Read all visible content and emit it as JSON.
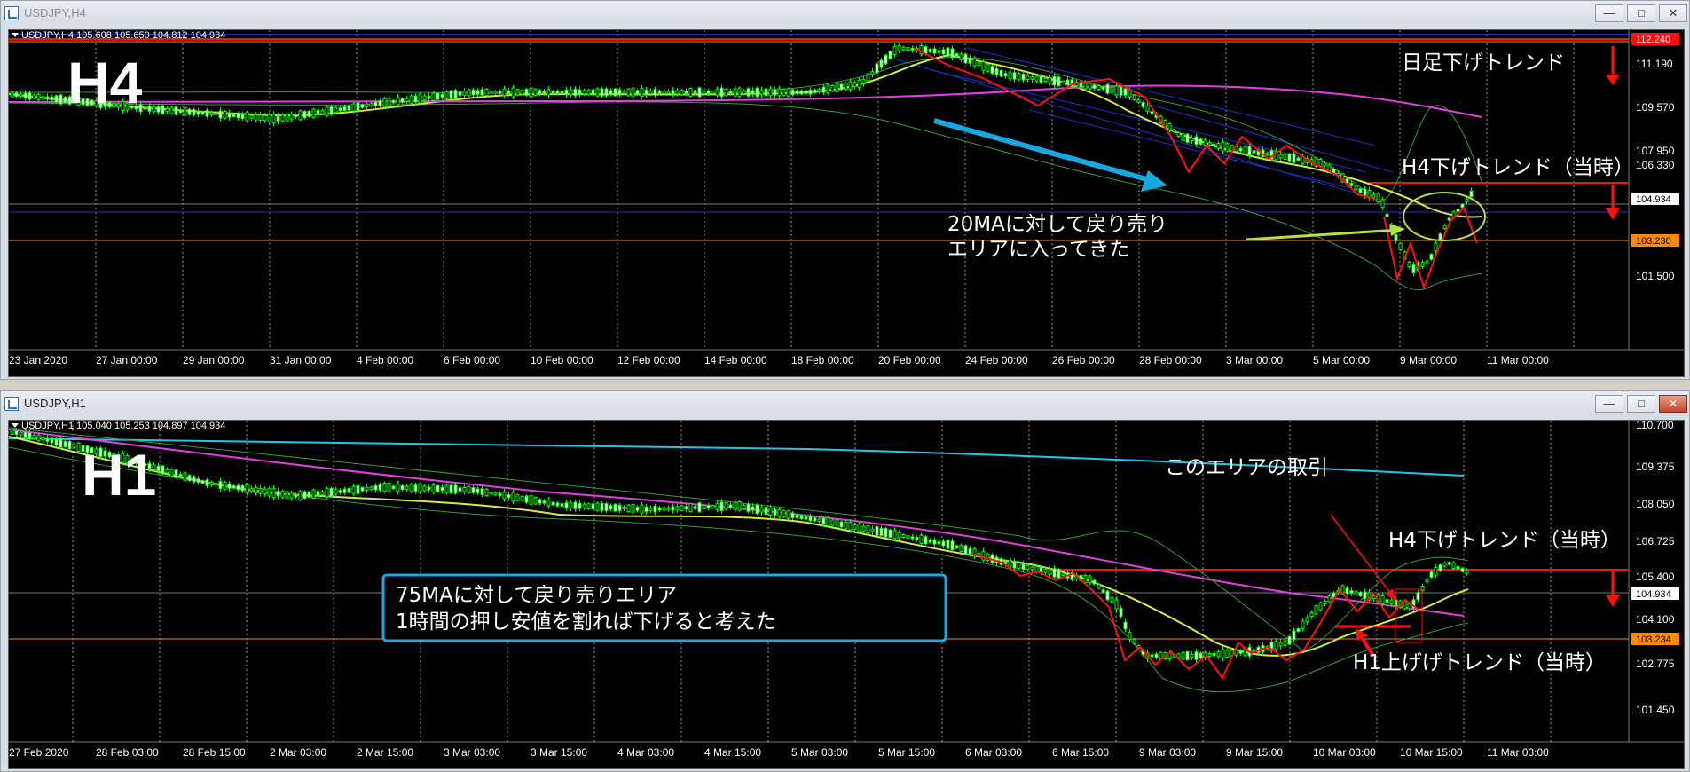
{
  "window_top": {
    "title": "USDJPY,H4",
    "info_line": "USDJPY,H4  105.608 105.650 104.812 104.934",
    "timeframe_label": "H4",
    "price_ticks": [
      "111.190",
      "109.570",
      "107.950",
      "106.330",
      "101.500"
    ],
    "price_tags": {
      "red": "112.240",
      "current": "104.934",
      "orange": "103.230"
    },
    "time_ticks": [
      "23 Jan 2020",
      "27 Jan 00:00",
      "29 Jan 00:00",
      "31 Jan 00:00",
      "4 Feb 00:00",
      "6 Feb 00:00",
      "10 Feb 00:00",
      "12 Feb 00:00",
      "14 Feb 00:00",
      "18 Feb 00:00",
      "20 Feb 00:00",
      "24 Feb 00:00",
      "26 Feb 00:00",
      "28 Feb 00:00",
      "3 Mar 00:00",
      "5 Mar 00:00",
      "9 Mar 00:00",
      "11 Mar 00:00"
    ],
    "annotations": {
      "daily_trend": "日足下げトレンド",
      "h4_trend": "H4下げトレンド（当時）",
      "retracement_line1": "20MAに対して戻り売り",
      "retracement_line2": "エリアに入ってきた"
    }
  },
  "window_bottom": {
    "title": "USDJPY,H1",
    "info_line": "USDJPY,H1  105.040 105.253 104.897 104.934",
    "timeframe_label": "H1",
    "price_ticks": [
      "110.700",
      "109.375",
      "108.050",
      "106.725",
      "105.400",
      "104.100",
      "102.775",
      "101.450"
    ],
    "price_tags": {
      "current": "104.934",
      "orange": "103.234"
    },
    "time_ticks": [
      "27 Feb 2020",
      "28 Feb 03:00",
      "28 Feb 15:00",
      "2 Mar 03:00",
      "2 Mar 15:00",
      "3 Mar 03:00",
      "3 Mar 15:00",
      "4 Mar 03:00",
      "4 Mar 15:00",
      "5 Mar 03:00",
      "5 Mar 15:00",
      "6 Mar 03:00",
      "6 Mar 15:00",
      "9 Mar 03:00",
      "9 Mar 15:00",
      "10 Mar 03:00",
      "10 Mar 15:00",
      "11 Mar 03:00"
    ],
    "annotations": {
      "this_area": "このエリアの取引",
      "h4_trend": "H4下げトレンド（当時）",
      "h1_trend": "H1上げげトレンド（当時）",
      "box_line1": "75MAに対して戻り売りエリア",
      "box_line2": "1時間の押し安値を割れば下げると考えた"
    }
  },
  "colors": {
    "chart_bg": "#000000",
    "candle_bull": "#00ff00",
    "ma_yellow": "#d8e84a",
    "ma_magenta": "#e040e0",
    "ma_cyan": "#22c8e8",
    "bollinger": "#3a9a3a",
    "trend_red": "#ff1010",
    "level_orange": "#ff8c00",
    "level_blue": "#2030d0",
    "box_cyan": "#18a8e0"
  }
}
